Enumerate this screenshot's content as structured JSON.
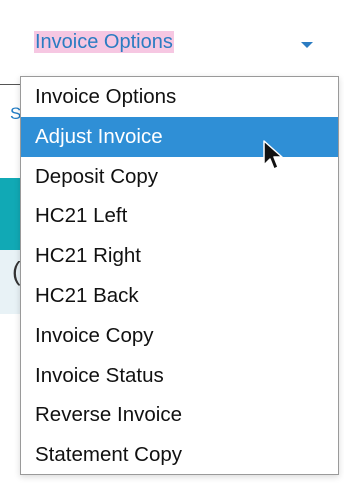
{
  "background": {
    "fragment_letter": "S",
    "fragment_paren": "("
  },
  "select": {
    "current_value": "Invoice Options",
    "options": [
      {
        "label": "Invoice Options",
        "selected": false
      },
      {
        "label": "Adjust Invoice",
        "selected": true
      },
      {
        "label": "Deposit Copy",
        "selected": false
      },
      {
        "label": "HC21 Left",
        "selected": false
      },
      {
        "label": "HC21 Right",
        "selected": false
      },
      {
        "label": "HC21 Back",
        "selected": false
      },
      {
        "label": "Invoice Copy",
        "selected": false
      },
      {
        "label": "Invoice Status",
        "selected": false
      },
      {
        "label": "Reverse Invoice",
        "selected": false
      },
      {
        "label": "Statement Copy",
        "selected": false
      }
    ]
  },
  "colors": {
    "accent": "#2b7cc2",
    "highlight": "#2f8fd6",
    "value_highlight": "#f6c7e2",
    "teal": "#11a9b5"
  },
  "icons": {
    "caret": "chevron-down-icon",
    "pointer": "mouse-cursor-icon"
  }
}
